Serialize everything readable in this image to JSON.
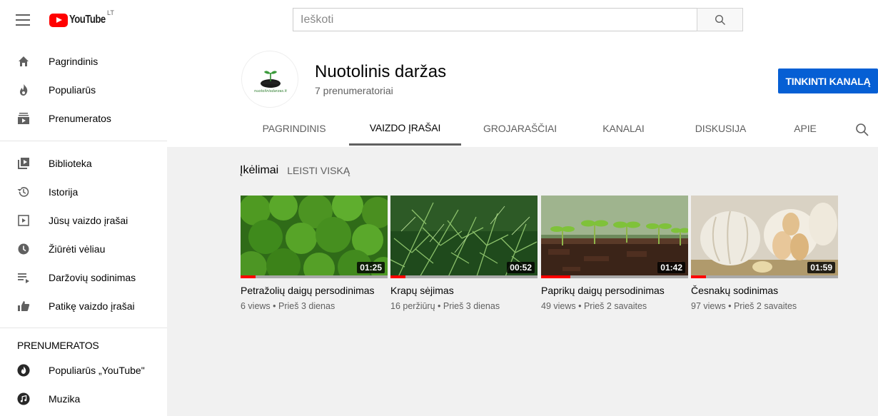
{
  "header": {
    "logo_text": "YouTube",
    "logo_country": "LT",
    "search_placeholder": "Ieškoti"
  },
  "sidebar": {
    "items_top": [
      {
        "label": "Pagrindinis",
        "icon": "home-icon"
      },
      {
        "label": "Populiarūs",
        "icon": "trending-icon"
      },
      {
        "label": "Prenumeratos",
        "icon": "subscriptions-icon"
      }
    ],
    "items_library": [
      {
        "label": "Biblioteka",
        "icon": "library-icon"
      },
      {
        "label": "Istorija",
        "icon": "history-icon"
      },
      {
        "label": "Jūsų vaizdo įrašai",
        "icon": "your-videos-icon"
      },
      {
        "label": "Žiūrėti vėliau",
        "icon": "watch-later-icon"
      },
      {
        "label": "Daržovių sodinimas",
        "icon": "playlist-icon"
      },
      {
        "label": "Patikę vaizdo įrašai",
        "icon": "thumbs-up-icon"
      }
    ],
    "subscriptions_heading": "PRENUMERATOS",
    "subscriptions": [
      {
        "label": "Populiarūs „YouTube\"",
        "icon": "popular-youtube-icon"
      },
      {
        "label": "Muzika",
        "icon": "music-icon"
      }
    ]
  },
  "channel": {
    "name": "Nuotolinis daržas",
    "subscribers": "7 prenumeratoriai",
    "avatar_caption": "nuotolinisdarzas.lt",
    "customize_label": "TINKINTI KANALĄ"
  },
  "tabs": [
    {
      "label": "PAGRINDINIS",
      "active": false
    },
    {
      "label": "VAIZDO ĮRAŠAI",
      "active": true
    },
    {
      "label": "GROJARAŠČIAI",
      "active": false
    },
    {
      "label": "KANALAI",
      "active": false
    },
    {
      "label": "DISKUSIJA",
      "active": false
    },
    {
      "label": "APIE",
      "active": false
    }
  ],
  "section": {
    "title": "Įkėlimai",
    "play_all": "LEISTI VISKĄ"
  },
  "videos": [
    {
      "title": "Petražolių daigų persodinimas",
      "meta": "6 views • Prieš 3 dienas",
      "duration": "01:25",
      "watched_fraction": 0.1
    },
    {
      "title": "Krapų sėjimas",
      "meta": "16 peržiūrų • Prieš 3 dienas",
      "duration": "00:52",
      "watched_fraction": 0.1
    },
    {
      "title": "Paprikų daigų persodinimas",
      "meta": "49 views • Prieš 2 savaites",
      "duration": "01:42",
      "watched_fraction": 0.2
    },
    {
      "title": "Česnakų sodinimas",
      "meta": "97 views • Prieš 2 savaites",
      "duration": "01:59",
      "watched_fraction": 0.1
    }
  ],
  "colors": {
    "accent": "#065fd4",
    "youtube_red": "#ff0000",
    "main_bg": "#f1f1f1"
  }
}
